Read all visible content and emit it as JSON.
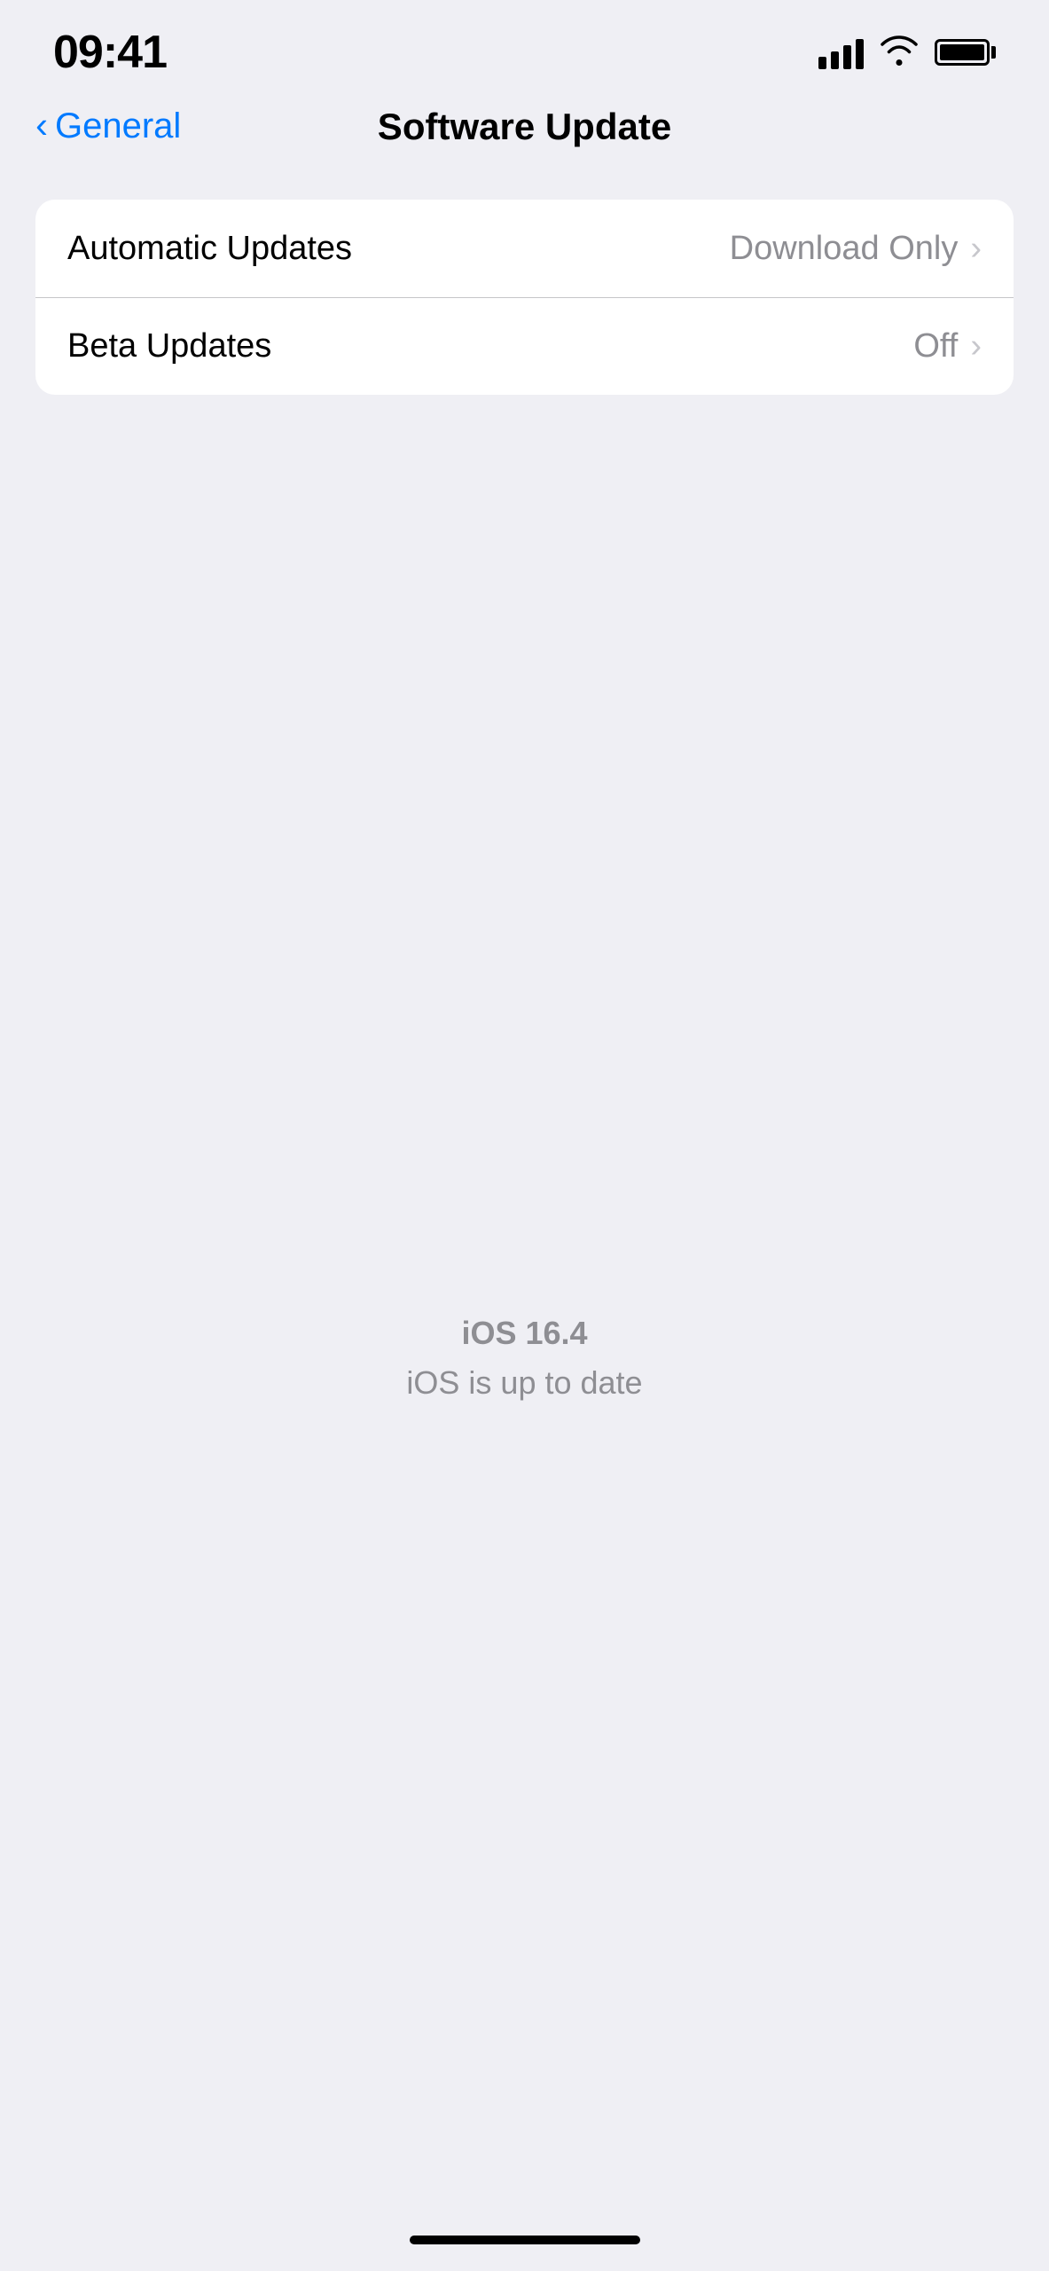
{
  "statusBar": {
    "time": "09:41",
    "signalBars": 4,
    "batteryFull": true
  },
  "header": {
    "backLabel": "General",
    "title": "Software Update"
  },
  "settingsRows": [
    {
      "label": "Automatic Updates",
      "value": "Download Only",
      "hasChevron": true
    },
    {
      "label": "Beta Updates",
      "value": "Off",
      "hasChevron": true
    }
  ],
  "centerInfo": {
    "version": "iOS 16.4",
    "statusText": "iOS is up to date"
  },
  "icons": {
    "backChevron": "‹",
    "rowChevron": "›"
  }
}
